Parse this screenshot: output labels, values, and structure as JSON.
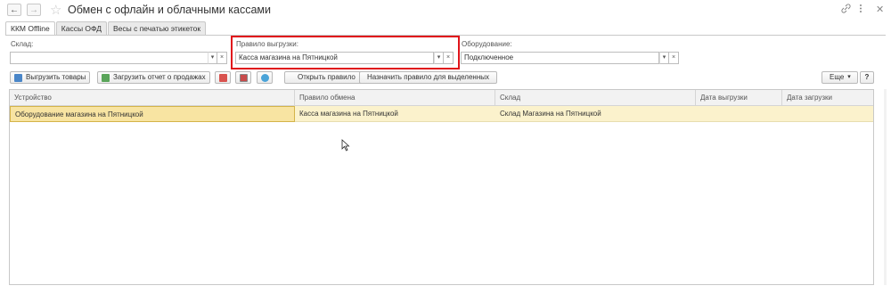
{
  "window": {
    "title": "Обмен с офлайн и облачными кассами",
    "back_icon": "←",
    "forward_icon": "→",
    "star_icon": "☆"
  },
  "tabs": [
    {
      "label": "ККМ Offline",
      "active": true
    },
    {
      "label": "Кассы ОФД",
      "active": false
    },
    {
      "label": "Весы с печатью этикеток",
      "active": false
    }
  ],
  "filters": {
    "warehouse": {
      "label": "Склад:",
      "value": ""
    },
    "rule": {
      "label": "Правило выгрузки:",
      "value": "Касса магазина на Пятницкой"
    },
    "equipment": {
      "label": "Оборудование:",
      "value": "Подключенное"
    }
  },
  "toolbar": {
    "export_goods": "Выгрузить товары",
    "load_report": "Загрузить отчет о продажах",
    "open_rule": "Открыть правило",
    "assign_rule": "Назначить правило для выделенных",
    "more": "Еще",
    "help": "?"
  },
  "table": {
    "columns": [
      "Устройство",
      "Правило обмена",
      "Склад",
      "Дата выгрузки",
      "Дата загрузки"
    ],
    "rows": [
      [
        "Оборудование магазина на Пятницкой",
        "Касса магазина на Пятницкой",
        "Склад Магазина на Пятницкой",
        "",
        ""
      ]
    ]
  },
  "colors": {
    "highlight": "#e0141b",
    "selected_row": "#fbf2cc",
    "selected_cell": "#f8e4a2"
  }
}
